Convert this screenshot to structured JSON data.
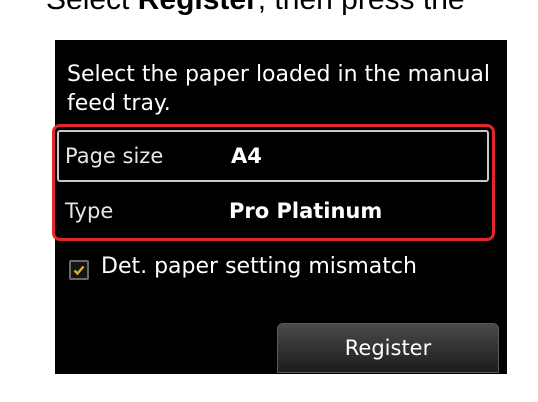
{
  "doc_caption": {
    "prefix": "Select ",
    "bold": "Register",
    "suffix": ", then press the"
  },
  "screen": {
    "message": "Select the paper loaded in the manual feed tray.",
    "settings": [
      {
        "label": "Page size",
        "value": "A4"
      },
      {
        "label": "Type",
        "value": "Pro Platinum"
      }
    ],
    "mismatch_checkbox": {
      "label": "Det. paper setting mismatch",
      "checked": true
    },
    "register_button": "Register"
  },
  "colors": {
    "highlight": "#e2262a",
    "checkmark": "#d8b420",
    "screen_background": "#000000"
  }
}
